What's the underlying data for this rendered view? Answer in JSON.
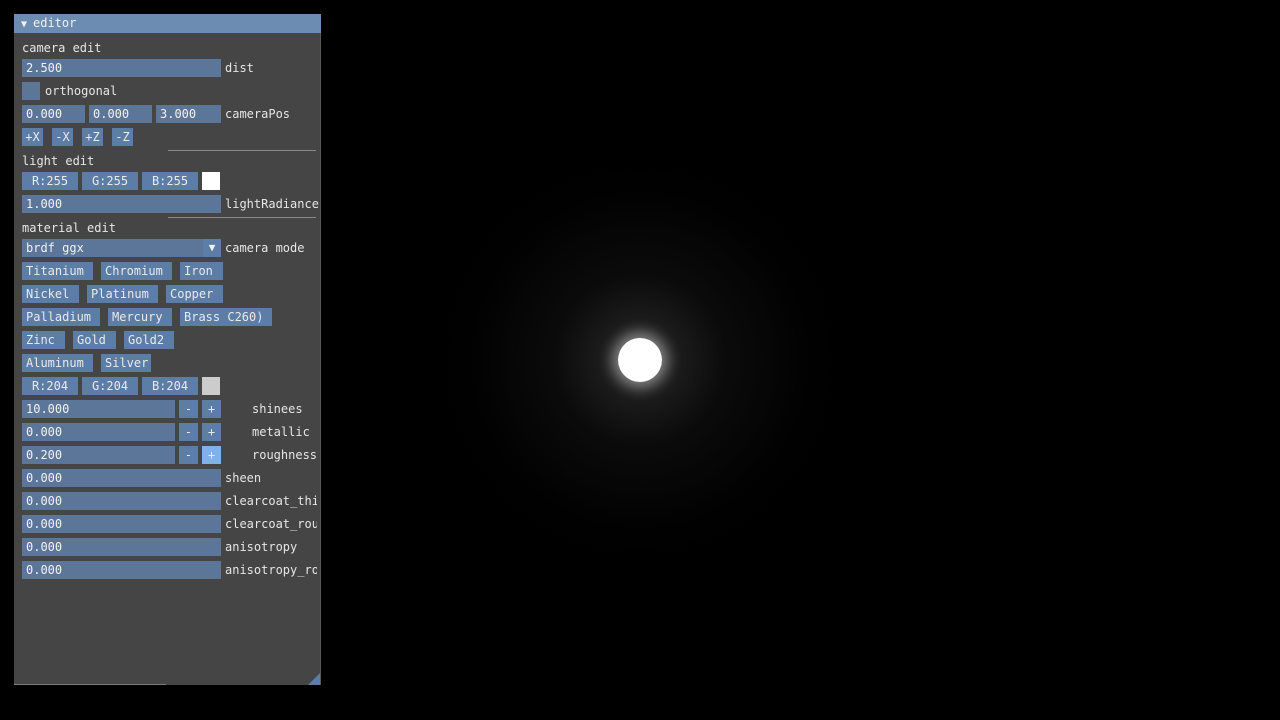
{
  "window": {
    "title": "editor",
    "collapse_icon": "triangle-down-icon"
  },
  "camera": {
    "section_label": "camera edit",
    "dist_value": "2.500",
    "dist_label": "dist",
    "orthogonal_label": "orthogonal",
    "pos_x": "0.000",
    "pos_y": "0.000",
    "pos_z": "3.000",
    "pos_label": "cameraPos",
    "buttons": [
      "+X",
      "-X",
      "+Z",
      "-Z"
    ]
  },
  "light": {
    "section_label": "light edit",
    "r": "R:255",
    "g": "G:255",
    "b": "B:255",
    "color": "#ffffff",
    "radiance_value": "1.000",
    "radiance_label": "lightRadiance"
  },
  "material": {
    "section_label": "material edit",
    "mode_value": "brdf ggx",
    "mode_label": "camera mode",
    "presets_row1": [
      "Titanium",
      "Chromium",
      "Iron"
    ],
    "presets_row2": [
      "Nickel",
      "Platinum",
      "Copper"
    ],
    "presets_row3": [
      "Palladium",
      "Mercury",
      "Brass C260)"
    ],
    "presets_row4": [
      "Zinc",
      "Gold",
      "Gold2"
    ],
    "presets_row5": [
      "Aluminum",
      "Silver"
    ],
    "r": "R:204",
    "g": "G:204",
    "b": "B:204",
    "color": "#cccccc",
    "shinees_value": "10.000",
    "shinees_label": "shinees",
    "metallic_value": "0.000",
    "metallic_label": "metallic",
    "roughness_value": "0.200",
    "roughness_label": "roughness",
    "minus": "-",
    "plus": "+",
    "sheen_value": "0.000",
    "sheen_label": "sheen",
    "clearcoat_thi_value": "0.000",
    "clearcoat_thi_label": "clearcoat_thi",
    "clearcoat_rou_value": "0.000",
    "clearcoat_rou_label": "clearcoat_rou",
    "anisotropy_value": "0.000",
    "anisotropy_label": "anisotropy",
    "anisotropy_ro_value": "0.000",
    "anisotropy_ro_label": "anisotropy_ro"
  },
  "colors": {
    "panel": "#454545",
    "title": "#6d8cb2",
    "widget": "#5c7699",
    "button": "#5c7da6",
    "active": "#7fb2e8"
  }
}
